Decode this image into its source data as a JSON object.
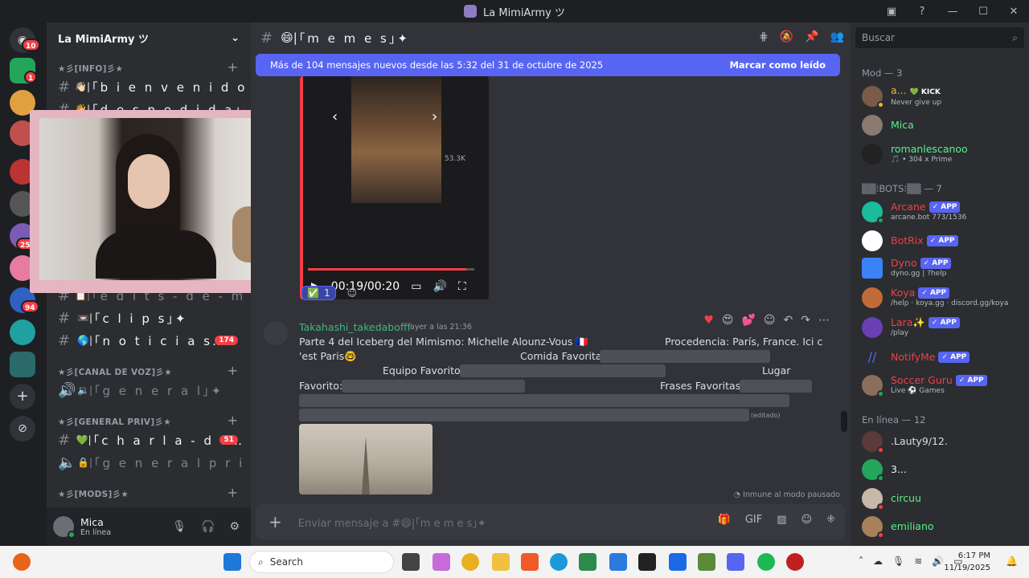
{
  "window": {
    "title": "La MimiArmy ツ"
  },
  "rail": {
    "badges": [
      "10",
      "1",
      "94",
      "250"
    ]
  },
  "server": {
    "name": "La MimiArmy ツ"
  },
  "channels": {
    "cat_info": "★彡[INFO]彡★",
    "ch_bienvenido": "｢b i e n v e n i d o…",
    "ch_despedida": "｢d e s p e d i d a｣✦",
    "ch_edits": "｢e d i t s - d e - m i c…",
    "ch_clips": "｢c l i p s｣✦",
    "ch_noticias": "｢n o t i c i a s…",
    "ch_noticias_badge": "174",
    "cat_voz": "★彡[CANAL DE VOZ]彡★",
    "ch_general_voz": "｢g e n e r a l｣✦",
    "cat_priv": "★彡[GENERAL PRIV]彡★",
    "ch_charla": "｢c h a r l a - d e…",
    "ch_charla_badge": "51",
    "ch_general_priv": "｢g e n e r a l p r i…",
    "cat_mods": "★彡[MODS]彡★"
  },
  "user": {
    "name": "Mica",
    "status": "En línea"
  },
  "header": {
    "channel": "｢m e m e s｣✦"
  },
  "newbar": {
    "text": "Más de 104 mensajes nuevos desde las 5:32 del 31 de octubre de 2025",
    "action": "Marcar como leído"
  },
  "video": {
    "time": "00:19/00:20",
    "likes": "53.3K"
  },
  "reaction": {
    "count": "1"
  },
  "message": {
    "author": "Takahashi_takedabofff",
    "time": "ayer a las 21:36",
    "line1": "Parte 4 del Iceberg del Mimismo: Michelle Alounz-Vous 🇫🇷",
    "line1b": "Procedencia: París, France. Ici c",
    "line2": "'est Paris🤓",
    "comida": "Comida Favorita:",
    "equipo": "Equipo Favorito:",
    "lugar": "Lugar",
    "favorito": "Favorito:",
    "frases": "Frases Favoritas:",
    "edited": "(editado)"
  },
  "immune": "Inmune al modo pausado",
  "composer": {
    "placeholder": "Enviar mensaje a #😄|｢m e m e s｣✦"
  },
  "members": {
    "search": "Buscar",
    "group_mod": "Mod — 3",
    "group_bots": "▒▒⁝BOTS⁝▒▒ — 7",
    "group_online": "En línea — 12",
    "mods": [
      {
        "name": "a...",
        "tag": "💚 KICK",
        "sub": "Never give up",
        "color": "#f0b232"
      },
      {
        "name": "Mica",
        "tag": "",
        "sub": "",
        "color": "#57f287"
      },
      {
        "name": "romanlescanoo",
        "tag": "",
        "sub": "🎵 • 304 x Prime",
        "color": "#57f287"
      }
    ],
    "bots": [
      {
        "name": "Arcane",
        "sub": "arcane.bot 773/1536",
        "color": "#f23f43"
      },
      {
        "name": "BotRix",
        "sub": "",
        "color": "#f23f43"
      },
      {
        "name": "Dyno",
        "sub": "dyno.gg | ?help",
        "color": "#f23f43"
      },
      {
        "name": "Koya",
        "sub": "/help · koya.gg · discord.gg/koya",
        "color": "#f23f43"
      },
      {
        "name": "Lara✨",
        "sub": "/play",
        "color": "#f23f43"
      },
      {
        "name": "NotifyMe",
        "sub": "",
        "color": "#f23f43"
      },
      {
        "name": "Soccer Guru",
        "sub": "Live ⚽ Games",
        "color": "#f23f43"
      }
    ],
    "app_tag": "✓ APP",
    "online": [
      {
        "name": ".Lauty9/12.",
        "color": "#dbdee1"
      },
      {
        "name": "3...",
        "color": "#f2f3f5"
      },
      {
        "name": "circuu",
        "color": "#57f287"
      },
      {
        "name": "emiliano",
        "color": "#57f287"
      }
    ]
  },
  "taskbar": {
    "search": "Search",
    "time": "6:17 PM",
    "date": "11/19/2025"
  }
}
